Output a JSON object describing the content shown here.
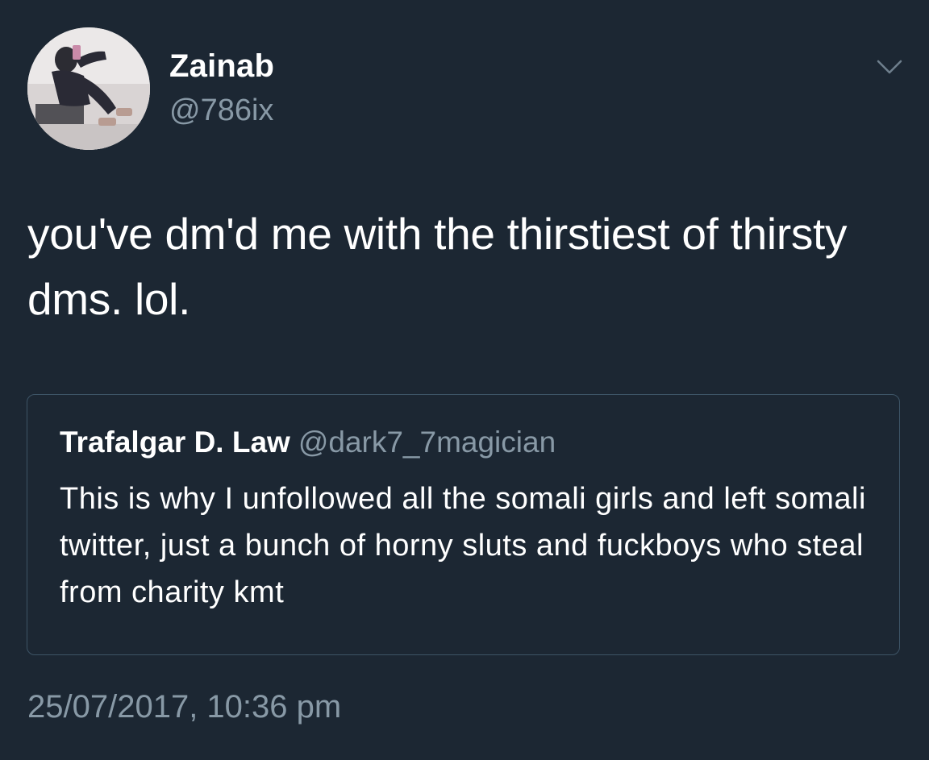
{
  "tweet": {
    "display_name": "Zainab",
    "handle": "@786ix",
    "text": "you've dm'd me with the thirstiest of thirsty dms. lol.",
    "timestamp": "25/07/2017, 10:36 pm",
    "menu_icon": "chevron-down-icon"
  },
  "quoted_tweet": {
    "display_name": "Trafalgar D. Law",
    "handle": "@dark7_7magician",
    "text": "This is why I unfollowed all the somali girls and left somali twitter, just a bunch of horny sluts and fuckboys who steal from charity kmt"
  },
  "colors": {
    "background": "#1c2733",
    "primary_text": "#ffffff",
    "secondary_text": "#8899a6",
    "quote_border": "#3d5466"
  }
}
